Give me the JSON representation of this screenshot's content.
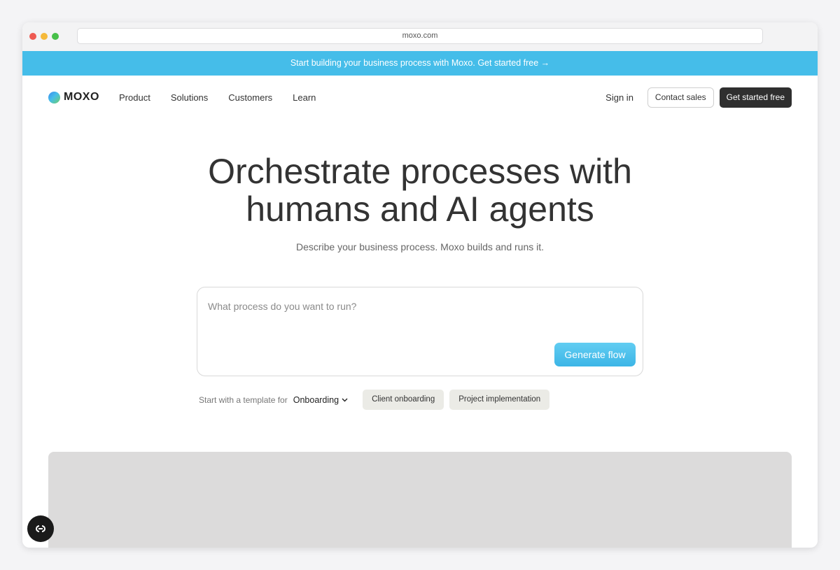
{
  "browser": {
    "url": "moxo.com"
  },
  "banner": {
    "text": "Start building your business process with Moxo. Get started free →"
  },
  "nav": {
    "logo_text": "MOXO",
    "links": [
      "Product",
      "Solutions",
      "Customers",
      "Learn"
    ],
    "sign_in": "Sign in",
    "contact_sales": "Contact sales",
    "get_started": "Get started free"
  },
  "hero": {
    "title_line1": "Orchestrate processes with",
    "title_line2": "humans and AI agents",
    "subtitle": "Describe your business process. Moxo builds and runs it."
  },
  "prompt": {
    "placeholder": "What process do you want to run?",
    "button": "Generate flow"
  },
  "templates": {
    "label": "Start with a template for",
    "selected": "Onboarding",
    "chips": [
      "Client onboarding",
      "Project implementation"
    ]
  },
  "colors": {
    "banner": "#45bde9",
    "primary_dark": "#2f2f2f",
    "accent": "#3cb5e6"
  }
}
